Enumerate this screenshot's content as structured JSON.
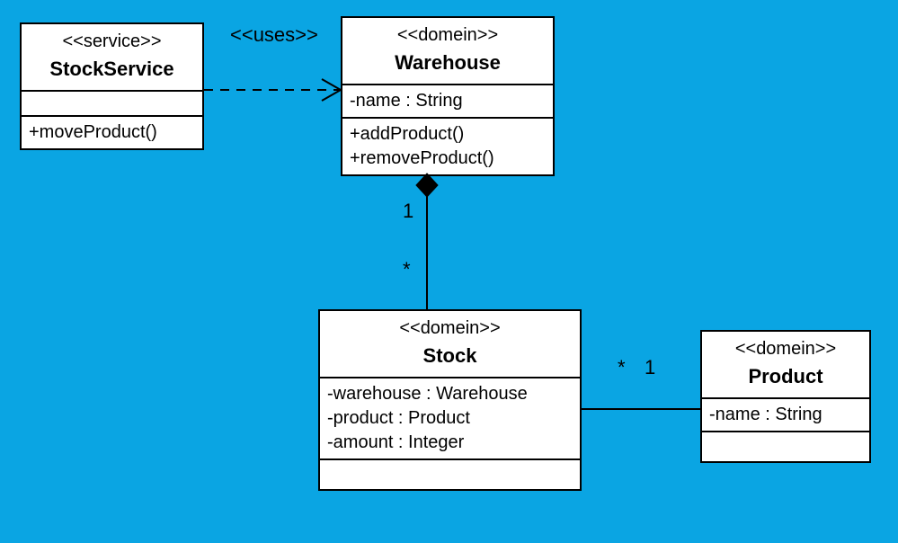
{
  "relationship_labels": {
    "uses": "<<uses>>"
  },
  "multiplicities": {
    "warehouse_to_stock_top": "1",
    "warehouse_to_stock_bottom": "*",
    "stock_to_product_left": "*",
    "stock_to_product_right": "1"
  },
  "classes": {
    "stockService": {
      "stereotype": "<<service>>",
      "name": "StockService",
      "attributes": [],
      "operations": [
        "+moveProduct()"
      ]
    },
    "warehouse": {
      "stereotype": "<<domein>>",
      "name": "Warehouse",
      "attributes": [
        "-name : String"
      ],
      "operations": [
        "+addProduct()",
        "+removeProduct()"
      ]
    },
    "stock": {
      "stereotype": "<<domein>>",
      "name": "Stock",
      "attributes": [
        "-warehouse : Warehouse",
        "-product : Product",
        "-amount : Integer"
      ],
      "operations": []
    },
    "product": {
      "stereotype": "<<domein>>",
      "name": "Product",
      "attributes": [
        "-name : String"
      ],
      "operations": []
    }
  }
}
